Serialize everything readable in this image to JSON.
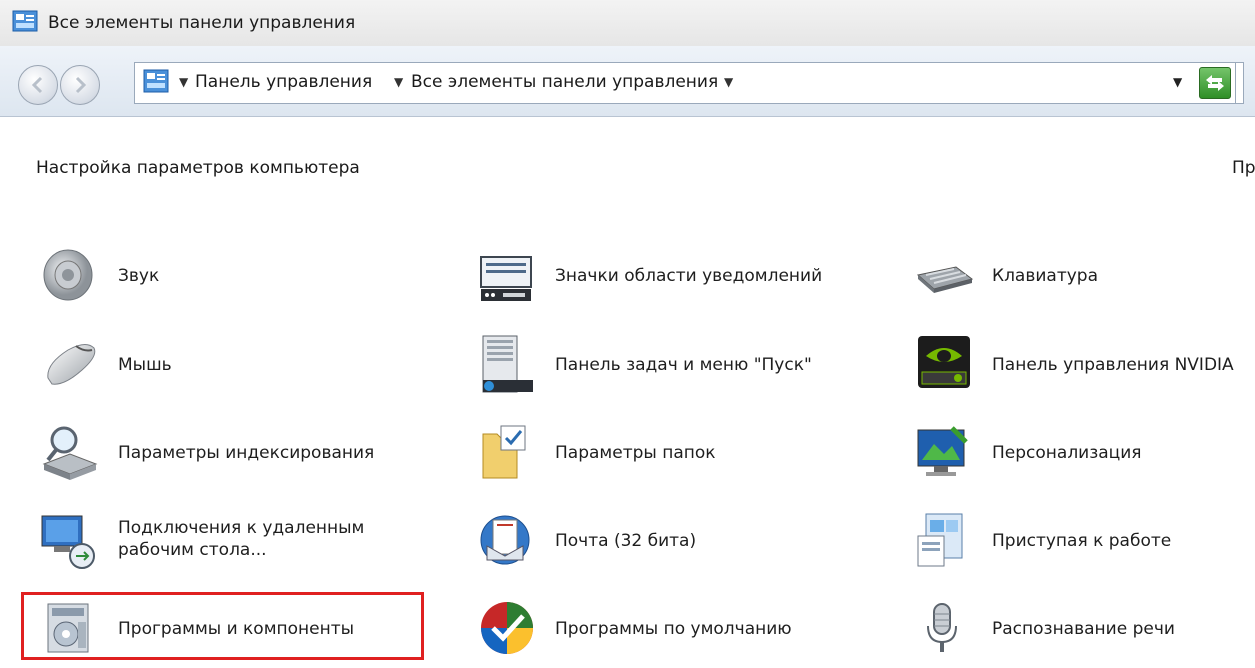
{
  "window": {
    "title": "Все элементы панели управления",
    "icon": "control-panel-icon"
  },
  "address_bar": {
    "crumbs": [
      "Панель управления",
      "Все элементы панели управления"
    ],
    "go_icon": "refresh-go-icon"
  },
  "content": {
    "heading": "Настройка параметров компьютера",
    "view_by_partial": "Пр"
  },
  "items": [
    {
      "label": "Звук",
      "icon": "speaker-icon"
    },
    {
      "label": "Значки области уведомлений",
      "icon": "notification-area-icon"
    },
    {
      "label": "Клавиатура",
      "icon": "keyboard-icon"
    },
    {
      "label": "Мышь",
      "icon": "mouse-icon"
    },
    {
      "label": "Панель задач и меню \"Пуск\"",
      "icon": "taskbar-icon"
    },
    {
      "label": "Панель управления NVIDIA",
      "icon": "nvidia-icon"
    },
    {
      "label": "Параметры индексирования",
      "icon": "indexing-icon"
    },
    {
      "label": "Параметры папок",
      "icon": "folder-options-icon"
    },
    {
      "label": "Персонализация",
      "icon": "personalization-icon"
    },
    {
      "label": "Подключения к удаленным рабочим стола...",
      "icon": "remote-desktop-icon"
    },
    {
      "label": "Почта (32 бита)",
      "icon": "mail-icon"
    },
    {
      "label": "Приступая к работе",
      "icon": "getting-started-icon"
    },
    {
      "label": "Программы и компоненты",
      "icon": "programs-features-icon"
    },
    {
      "label": "Программы по умолчанию",
      "icon": "default-programs-icon"
    },
    {
      "label": "Распознавание речи",
      "icon": "microphone-icon"
    }
  ],
  "highlight_color": "#e02020"
}
